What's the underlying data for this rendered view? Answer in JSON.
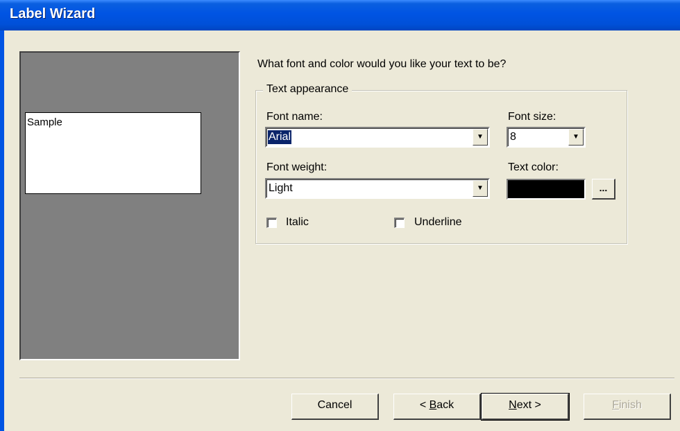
{
  "window": {
    "title": "Label Wizard"
  },
  "preview": {
    "sample_text": "Sample"
  },
  "prompt": {
    "question": "What font and color would you like your text to be?"
  },
  "group": {
    "label": "Text appearance",
    "font_name": {
      "label": "Font name:",
      "value": "Arial"
    },
    "font_size": {
      "label": "Font size:",
      "value": "8"
    },
    "font_weight": {
      "label": "Font weight:",
      "value": "Light"
    },
    "text_color": {
      "label": "Text color:",
      "value_color": "#000000",
      "picker_label": "..."
    },
    "italic": {
      "label": "Italic",
      "checked": false
    },
    "underline": {
      "label": "Underline",
      "checked": false
    }
  },
  "buttons": {
    "cancel": "Cancel",
    "back_prefix": "< ",
    "back_mnemonic": "B",
    "back_rest": "ack",
    "next_mnemonic": "N",
    "next_rest": "ext >",
    "finish_mnemonic": "F",
    "finish_rest": "inish"
  },
  "icons": {
    "dropdown": "chevron-down-icon"
  }
}
